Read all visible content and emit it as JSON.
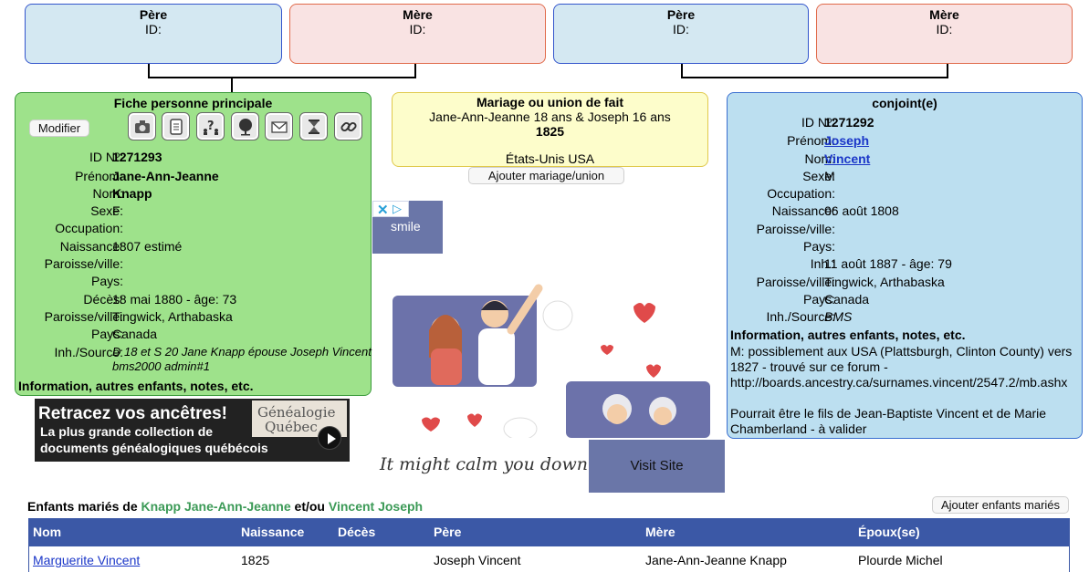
{
  "parents": {
    "left_father": {
      "label": "Père",
      "id_label": "ID:"
    },
    "left_mother": {
      "label": "Mère",
      "id_label": "ID:"
    },
    "right_father": {
      "label": "Père",
      "id_label": "ID:"
    },
    "right_mother": {
      "label": "Mère",
      "id_label": "ID:"
    }
  },
  "main_person": {
    "title": "Fiche personne principale",
    "edit_button": "Modifier",
    "icons": [
      "camera-icon",
      "document-icon",
      "family-help-icon",
      "tree-icon",
      "mail-icon",
      "hourglass-icon",
      "link-icon"
    ],
    "fields": [
      {
        "label": "ID Nº:",
        "value": "1271293",
        "style": "b"
      },
      {
        "label": "Prénom:",
        "value": "Jane-Ann-Jeanne",
        "style": "b"
      },
      {
        "label": "Nom:",
        "value": "Knapp",
        "style": "b"
      },
      {
        "label": "Sexe:",
        "value": "F",
        "style": ""
      },
      {
        "label": "Occupation:",
        "value": "",
        "style": ""
      },
      {
        "label": "Naissance:",
        "value": "1807 estimé",
        "style": ""
      },
      {
        "label": "Paroisse/ville:",
        "value": "",
        "style": ""
      },
      {
        "label": "Pays:",
        "value": "",
        "style": ""
      },
      {
        "label": "Décès:",
        "value": "18 mai 1880 - âge: 73",
        "style": ""
      },
      {
        "label": "Paroisse/ville:",
        "value": "Tingwick, Arthabaska",
        "style": ""
      },
      {
        "label": "Pays:",
        "value": "Canada",
        "style": ""
      }
    ],
    "source_label": "Inh./Source:",
    "source_line1": "D 18 et S 20 Jane Knapp épouse Joseph Vincent",
    "source_line2": "bms2000 admin#1",
    "info_title": "Information, autres enfants, notes, etc."
  },
  "marriage": {
    "title": "Mariage ou union de fait",
    "couple": "Jane-Ann-Jeanne 18 ans & Joseph 16 ans",
    "year": "1825",
    "place": "États-Unis USA",
    "add_button": "Ajouter mariage/union"
  },
  "ad": {
    "tab_text": "smile",
    "tagline": "It might calm you down",
    "cta": "Visit Site"
  },
  "promo": {
    "headline": "Retracez vos ancêtres!",
    "line1": "La plus grande collection de",
    "line2": "documents généalogiques québécois",
    "brand1": "Généalogie",
    "brand2": "Québec"
  },
  "spouse": {
    "title": "conjoint(e)",
    "fields": [
      {
        "label": "ID Nº:",
        "value": "1271292",
        "style": "b"
      },
      {
        "label": "Prénom:",
        "value": "Joseph",
        "style": "lnk"
      },
      {
        "label": "Nom:",
        "value": "Vincent",
        "style": "lnk"
      },
      {
        "label": "Sexe:",
        "value": "M",
        "style": ""
      },
      {
        "label": "Occupation:",
        "value": "",
        "style": ""
      },
      {
        "label": "Naissance:",
        "value": "06 août 1808",
        "style": ""
      },
      {
        "label": "Paroisse/ville:",
        "value": "",
        "style": ""
      },
      {
        "label": "Pays:",
        "value": "",
        "style": ""
      },
      {
        "label": "Inh.:",
        "value": "11 août 1887 - âge: 79",
        "style": ""
      },
      {
        "label": "Paroisse/ville:",
        "value": "Tingwick, Arthabaska",
        "style": ""
      },
      {
        "label": "Pays:",
        "value": "Canada",
        "style": ""
      },
      {
        "label": "Inh./Source:",
        "value": "BMS",
        "style": "i"
      }
    ],
    "info_title": "Information, autres enfants, notes, etc.",
    "note1_l1": "M: possiblement aux USA (Plattsburgh, Clinton County) vers",
    "note1_l2": "1827 - trouvé sur ce forum -",
    "note1_l3": "http://boards.ancestry.ca/surnames.vincent/2547.2/mb.ashx",
    "note2_l1": "Pourrait être le fils de Jean-Baptiste Vincent et de Marie",
    "note2_l2": "Chamberland - à valider"
  },
  "children": {
    "heading_prefix": "Enfants mariés de",
    "person1": "Knapp Jane-Ann-Jeanne",
    "connector": "et/ou",
    "person2": "Vincent Joseph",
    "add_button": "Ajouter enfants mariés",
    "columns": [
      "Nom",
      "Naissance",
      "Décès",
      "Père",
      "Mère",
      "Époux(se)"
    ],
    "rows": [
      {
        "name": "Marguerite Vincent",
        "birth": "1825",
        "death": "",
        "father": "Joseph Vincent",
        "mother": "Jane-Ann-Jeanne Knapp",
        "spouse": "Plourde Michel"
      }
    ]
  },
  "colors": {
    "main_card": "#9ee28b",
    "spouse_card": "#bcdff0",
    "marriage_card": "#fdfdcb",
    "table_header": "#3b58a6",
    "heading_green": "#3c9a57"
  }
}
